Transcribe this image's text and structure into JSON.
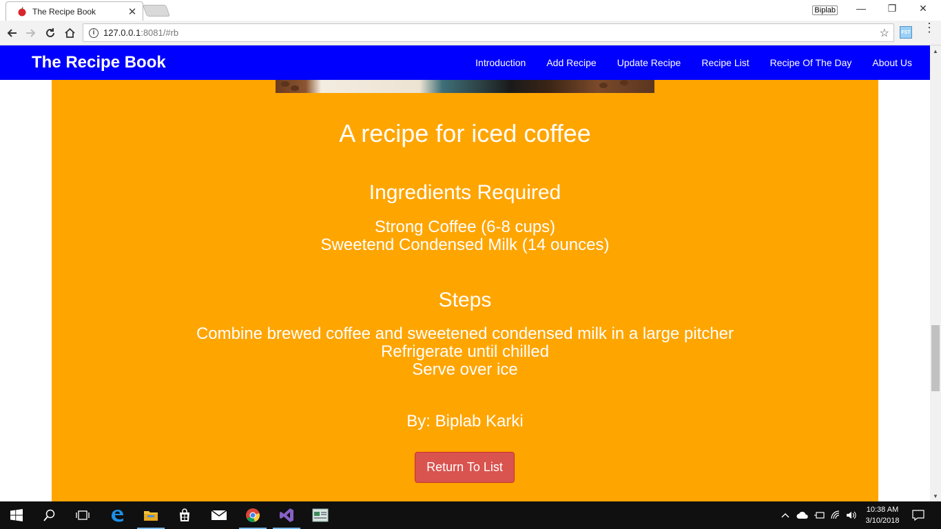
{
  "browser": {
    "tab_title": "The Recipe Book",
    "profile_name": "Biplab",
    "url_host": "127.0.0.1",
    "url_rest": ":8081/#rb"
  },
  "navbar": {
    "brand": "The Recipe Book",
    "links": [
      "Introduction",
      "Add Recipe",
      "Update Recipe",
      "Recipe List",
      "Recipe Of The Day",
      "About Us"
    ],
    "color": "#0000ff"
  },
  "recipe": {
    "title": "A recipe for iced coffee",
    "ingredients_heading": "Ingredients Required",
    "ingredients": [
      "Strong Coffee (6-8 cups)",
      "Sweetend Condensed Milk (14 ounces)"
    ],
    "steps_heading": "Steps",
    "steps": [
      "Combine brewed coffee and sweetened condensed milk in a large pitcher",
      "Refrigerate until chilled",
      "Serve over ice"
    ],
    "author": "By: Biplab Karki",
    "return_button": "Return To List",
    "background_color": "#ffa500",
    "button_color": "#d9534f"
  },
  "taskbar": {
    "time": "10:38 AM",
    "date": "3/10/2018"
  }
}
